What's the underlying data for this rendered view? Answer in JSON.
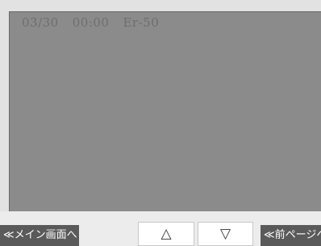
{
  "log": {
    "date": "03/30",
    "time": "00:00",
    "code": "Er-50"
  },
  "buttons": {
    "main_screen": "≪メイン画面へ",
    "prev_page": "≪前ページへ",
    "up_arrow": "△",
    "down_arrow": "▽"
  }
}
